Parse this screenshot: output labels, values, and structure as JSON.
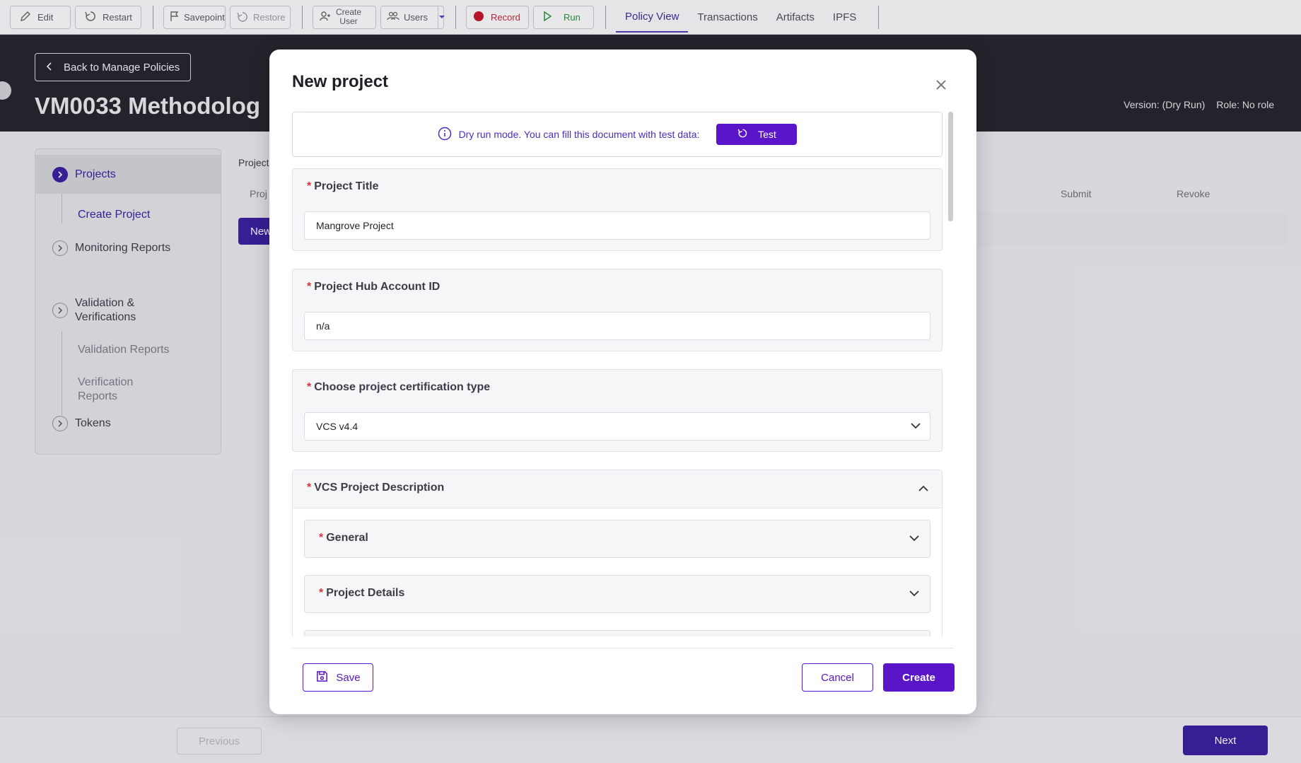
{
  "toolbar": {
    "edit": "Edit",
    "restart": "Restart",
    "savepoint": "Savepoint",
    "restore": "Restore",
    "create_user_line1": "Create",
    "create_user_line2": "User",
    "users": "Users",
    "record": "Record",
    "run": "Run",
    "tabs": [
      "Policy View",
      "Transactions",
      "Artifacts",
      "IPFS"
    ]
  },
  "header": {
    "back_label": "Back to Manage Policies",
    "title": "VM0033 Methodolog",
    "version": "Version: (Dry Run)",
    "role": "Role: No role"
  },
  "nav": {
    "projects": "Projects",
    "create_project": "Create Project",
    "monitoring_reports": "Monitoring Reports",
    "validation_line1": "Validation &",
    "validation_line2": "Verifications",
    "validation_reports": "Validation Reports",
    "verification_line1": "Verification",
    "verification_line2": "Reports",
    "tokens": "Tokens"
  },
  "background": {
    "projects_label": "Project",
    "col_proj": "Proj",
    "col_submit": "Submit",
    "col_revoke": "Revoke",
    "new_button": "New"
  },
  "footer": {
    "previous": "Previous",
    "next": "Next"
  },
  "modal": {
    "title": "New project",
    "dry_run_text": "Dry run mode. You can fill this document with test data:",
    "test_label": "Test",
    "project_title_label": "Project Title",
    "project_title_value": "Mangrove Project",
    "hub_account_label": "Project Hub Account ID",
    "hub_account_value": "n/a",
    "cert_type_label": "Choose project certification type",
    "cert_type_value": "VCS v4.4",
    "vcs_description_label": "VCS Project Description",
    "general_label": "General",
    "project_details_label": "Project Details",
    "save": "Save",
    "cancel": "Cancel",
    "create": "Create"
  },
  "colors": {
    "accent": "#5a15c8",
    "dark_header": "#24252c",
    "required": "#d8333f"
  }
}
